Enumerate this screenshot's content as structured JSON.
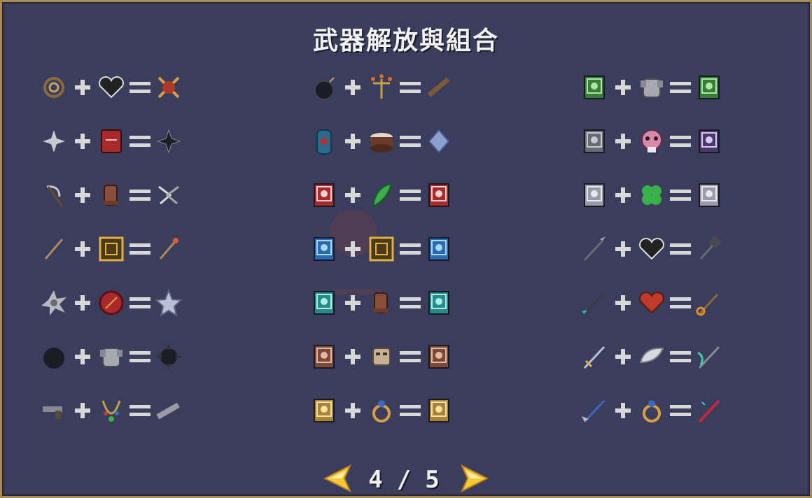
{
  "title": "武器解放與組合",
  "symbols": {
    "plus": "+",
    "equals": "="
  },
  "pagination": {
    "current": "4",
    "separator": "/",
    "total": "5"
  },
  "colors": {
    "panel": "#3a3d5c",
    "border": "#a88a54",
    "arrow": "#f5c93a",
    "operator": "#d8d8d8",
    "text": "#f2f2f2"
  },
  "columns": [
    [
      [
        "whip-icon",
        "heart-dark-icon",
        "skull-cross-icon"
      ],
      [
        "shuriken-icon",
        "red-tome-icon",
        "black-shuriken-icon"
      ],
      [
        "scythe-icon",
        "gauntlet-icon",
        "crossed-scythe-icon"
      ],
      [
        "staff-icon",
        "gold-frame-icon",
        "fire-staff-icon"
      ],
      [
        "gear-spike-icon",
        "shield-red-icon",
        "steel-star-icon"
      ],
      [
        "bomb-ball-icon",
        "armor-icon",
        "spiked-ball-icon"
      ],
      [
        "pistol-icon",
        "necklace-icon",
        "gun-icon"
      ]
    ],
    [
      [
        "bomb-icon",
        "candelabra-icon",
        "rifle-icon"
      ],
      [
        "lantern-icon",
        "cake-icon",
        "crystal-icon"
      ],
      [
        "red-book-icon",
        "green-feather-icon",
        "red-book-icon"
      ],
      [
        "blue-book-icon",
        "gold-frame-icon",
        "blue-book-icon"
      ],
      [
        "teal-book-icon",
        "gauntlet-icon",
        "teal-book-icon"
      ],
      [
        "brown-book-icon",
        "mask-icon",
        "brown-book-icon"
      ],
      [
        "gold-book-icon",
        "ring-icon",
        "gold-book-icon"
      ]
    ],
    [
      [
        "green-book-icon",
        "armor-icon",
        "green-book-icon"
      ],
      [
        "gray-book-icon",
        "pink-skull-icon",
        "purple-book-icon"
      ],
      [
        "silver-book-icon",
        "clover-icon",
        "silver-book-icon"
      ],
      [
        "spear-icon",
        "heart-dark-icon",
        "hammer-icon"
      ],
      [
        "teal-spear-icon",
        "heart-red-icon",
        "fire-spear-icon"
      ],
      [
        "gold-sword-icon",
        "wing-icon",
        "teal-sword-icon"
      ],
      [
        "blue-sword-icon",
        "ring-icon",
        "red-sword-icon"
      ]
    ]
  ]
}
